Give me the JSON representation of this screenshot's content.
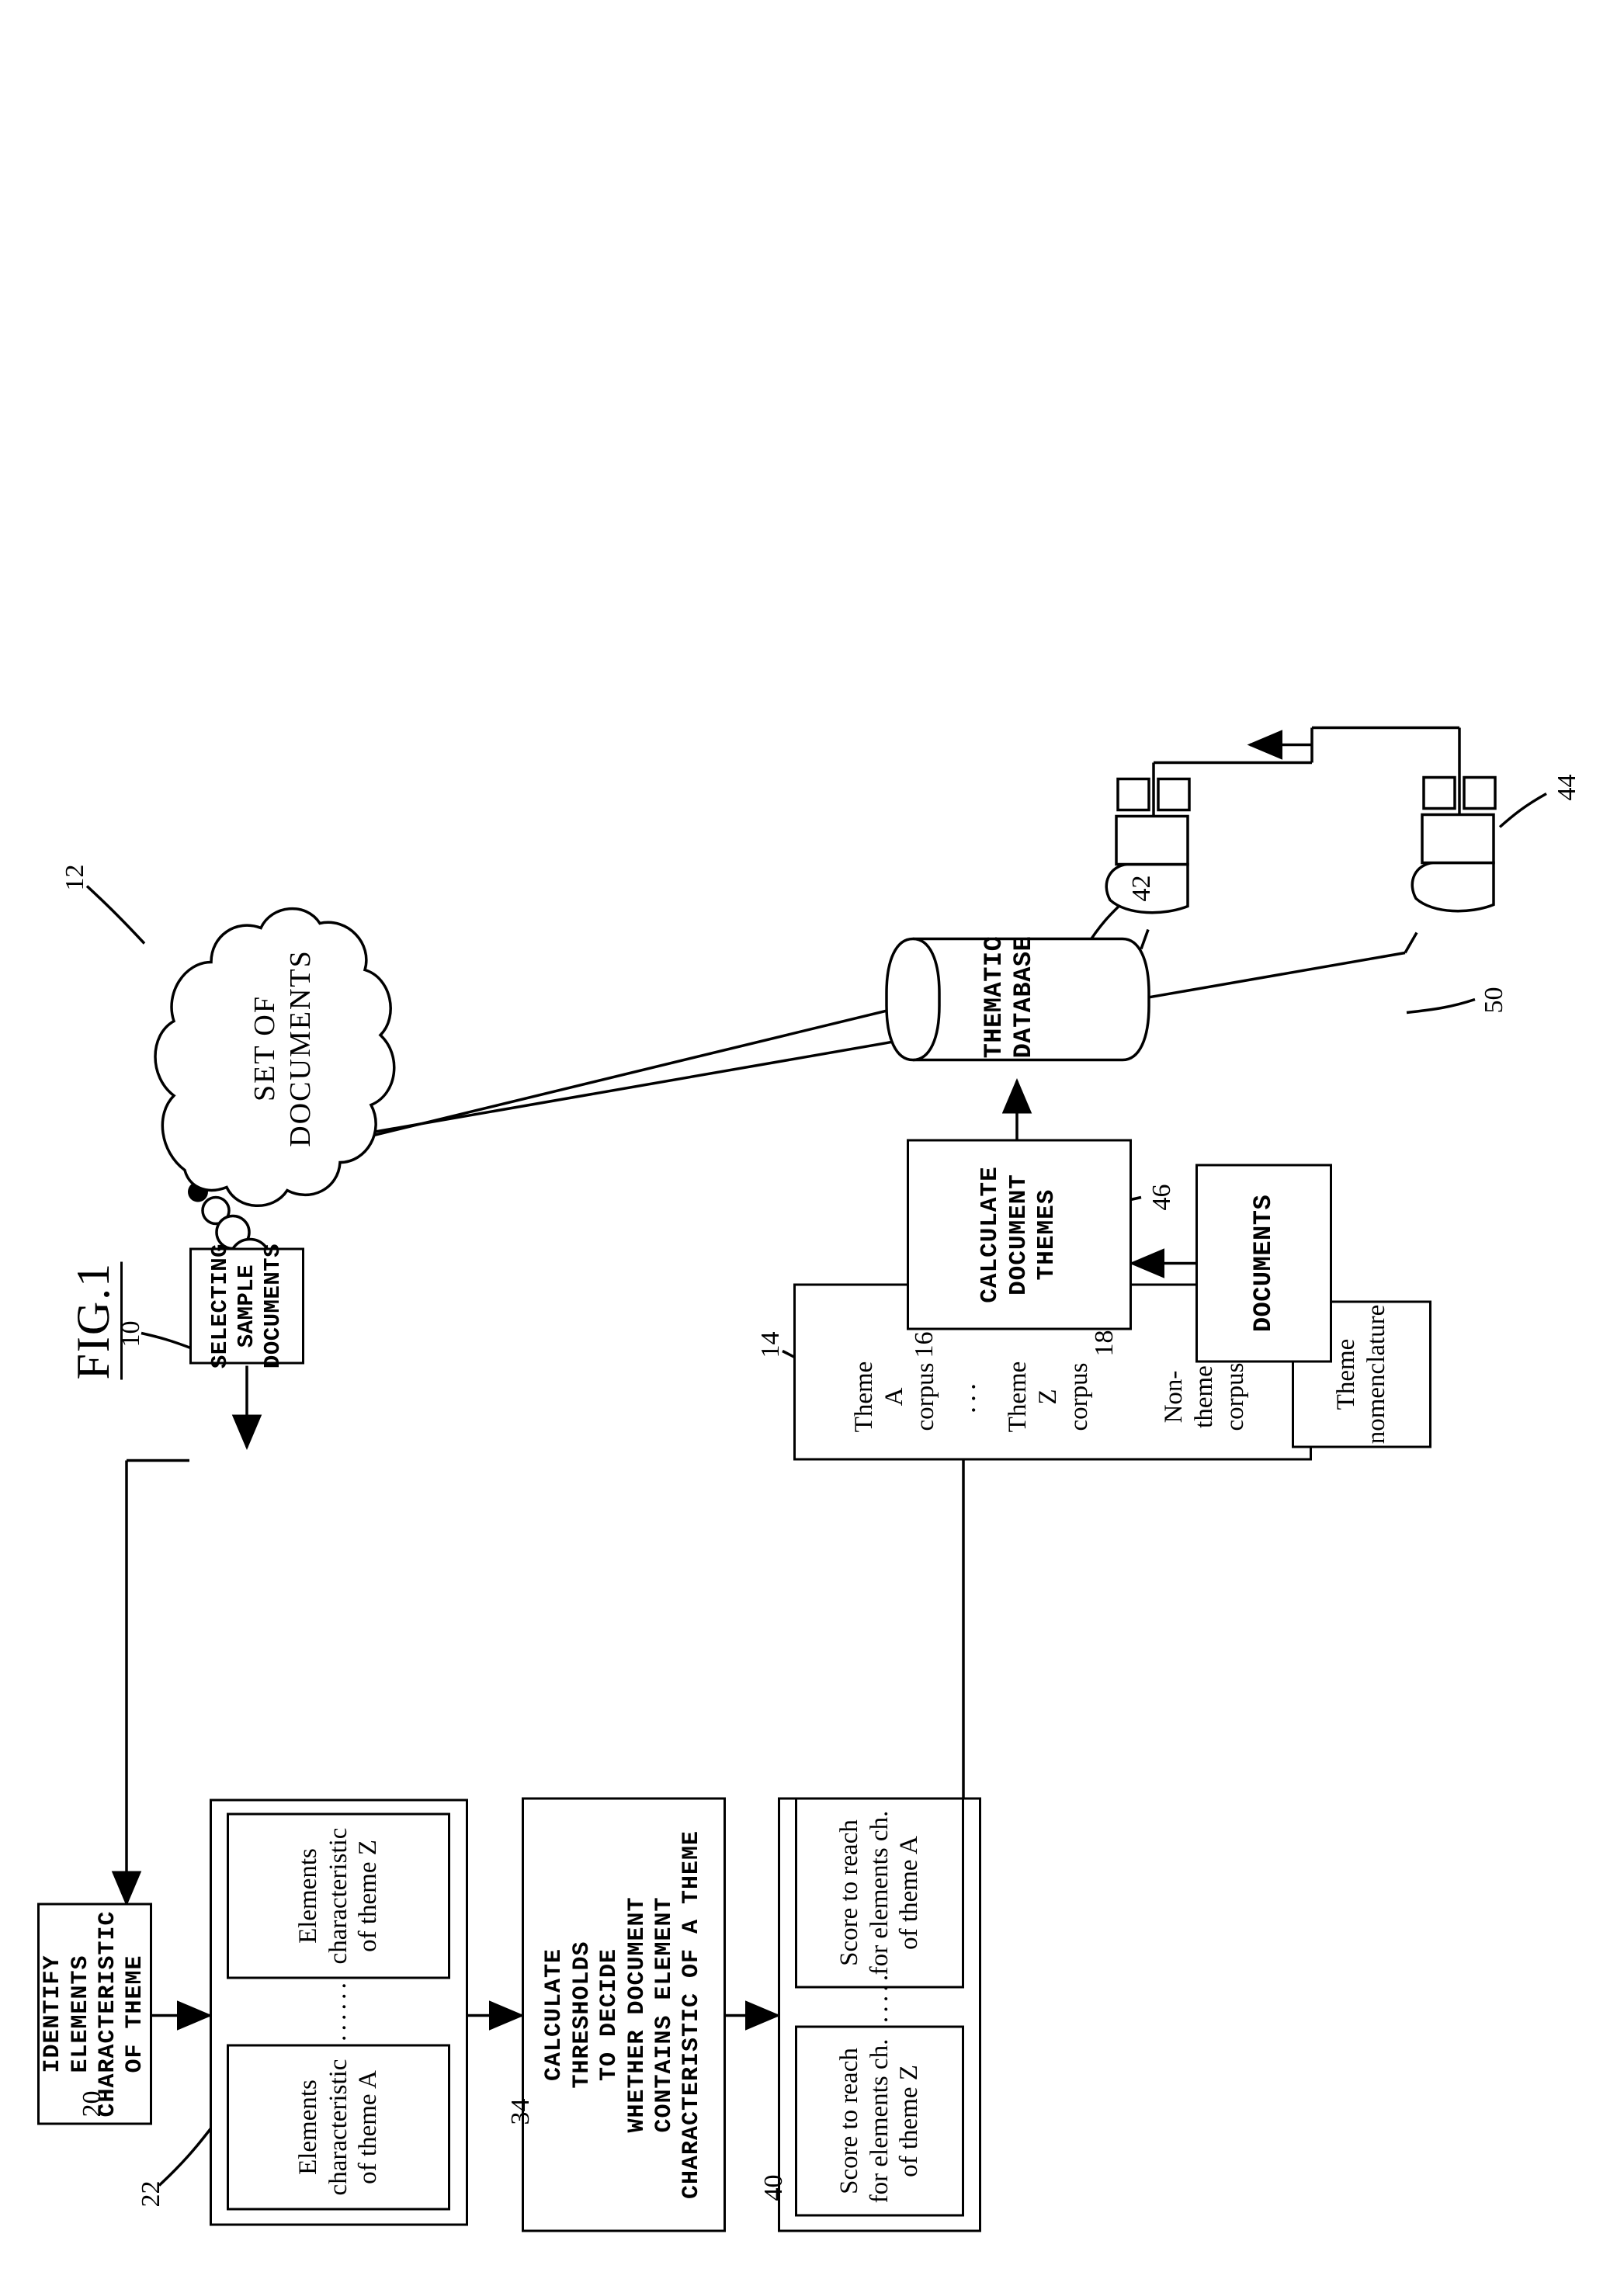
{
  "figure": {
    "title": "FIG.1"
  },
  "nodes": {
    "set_of_documents": "SET OF\nDOCUMENTS",
    "selecting_sample_documents": "SELECTING\nSAMPLE\nDOCUMENTS",
    "identify_elements": "IDENTIFY\nELEMENTS\nCHARACTERISTIC\nOF  THEME",
    "elements_theme_a": "Elements\ncharacteristic\nof theme A",
    "elements_theme_z": "Elements\ncharacteristic\nof theme Z",
    "calculate_thresholds": "CALCULATE\nTHRESHOLDS\nTO DECIDE\nWHETHER DOCUMENT\nCONTAINS ELEMENT\nCHARACTERISTIC OF  A  THEME",
    "score_theme_a": "Score to reach\nfor elements ch.\nof theme A",
    "score_theme_z": "Score to reach\nfor elements ch.\nof theme Z",
    "theme_a_corpus": "Theme A\ncorpus",
    "theme_z_corpus": "Theme Z\ncorpus",
    "non_theme_corpus": "Non-\ntheme\ncorpus",
    "theme_nomenclature": "Theme\nnomenclature",
    "thematic_database": "THEMATIC\nDATABASE",
    "calculate_document_themes": "CALCULATE\nDOCUMENT\nTHEMES",
    "documents": "DOCUMENTS",
    "ellipsis_corpus": "...",
    "ellipsis_elements": "......",
    "ellipsis_scores": "....."
  },
  "reference_numerals": {
    "n10": "10",
    "n12": "12",
    "n14": "14",
    "n16": "16",
    "n18": "18",
    "n20": "20",
    "n22": "22",
    "n34": "34",
    "n40": "40",
    "n42": "42",
    "n44": "44",
    "n46": "46",
    "n50": "50"
  },
  "colors": {
    "ink": "#000000",
    "paper": "#ffffff"
  }
}
